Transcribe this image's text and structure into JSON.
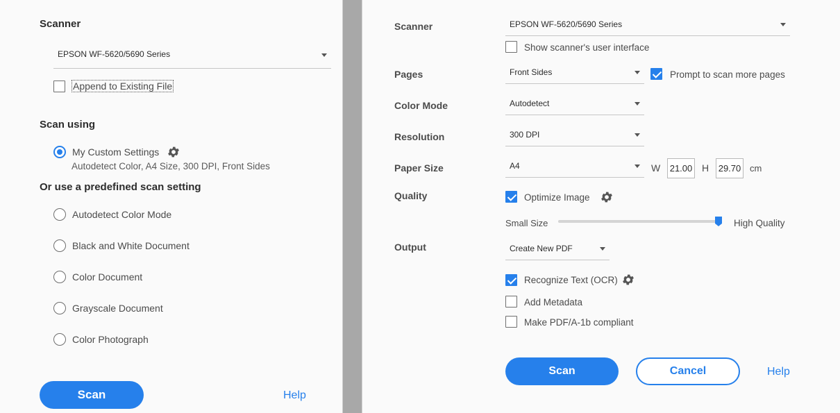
{
  "left": {
    "scanner_label": "Scanner",
    "scanner_value": "EPSON WF-5620/5690 Series",
    "append_label": "Append to Existing File",
    "append_checked": false,
    "scan_using_label": "Scan using",
    "custom_settings_label": "My Custom Settings",
    "custom_settings_desc": "Autodetect Color, A4 Size, 300 DPI, Front Sides",
    "predefined_label": "Or use a predefined scan setting",
    "presets": [
      {
        "label": "Autodetect Color Mode"
      },
      {
        "label": "Black and White Document"
      },
      {
        "label": "Color Document"
      },
      {
        "label": "Grayscale Document"
      },
      {
        "label": "Color Photograph"
      }
    ],
    "scan_button": "Scan",
    "help_link": "Help"
  },
  "right": {
    "scanner_label": "Scanner",
    "scanner_value": "EPSON WF-5620/5690 Series",
    "show_ui_label": "Show scanner's user interface",
    "show_ui_checked": false,
    "pages_label": "Pages",
    "pages_value": "Front Sides",
    "prompt_more_label": "Prompt to scan more pages",
    "prompt_more_checked": true,
    "color_mode_label": "Color Mode",
    "color_mode_value": "Autodetect",
    "resolution_label": "Resolution",
    "resolution_value": "300 DPI",
    "paper_size_label": "Paper Size",
    "paper_size_value": "A4",
    "width_label": "W",
    "width_value": "21.00",
    "height_label": "H",
    "height_value": "29.70",
    "unit_label": "cm",
    "quality_label": "Quality",
    "optimize_label": "Optimize Image",
    "optimize_checked": true,
    "small_size_label": "Small Size",
    "high_quality_label": "High Quality",
    "quality_level": 1.0,
    "output_label": "Output",
    "output_value": "Create New PDF",
    "ocr_label": "Recognize Text (OCR)",
    "ocr_checked": true,
    "metadata_label": "Add Metadata",
    "metadata_checked": false,
    "pdfa_label": "Make PDF/A-1b compliant",
    "pdfa_checked": false,
    "scan_button": "Scan",
    "cancel_button": "Cancel",
    "help_link": "Help"
  },
  "colors": {
    "accent": "#2680eb",
    "divider": "#a8a8a8",
    "panel_bg": "#fafafa"
  },
  "icons": [
    "gear-icon",
    "chevron-down-icon",
    "checkmark-icon",
    "slider-thumb-icon"
  ]
}
